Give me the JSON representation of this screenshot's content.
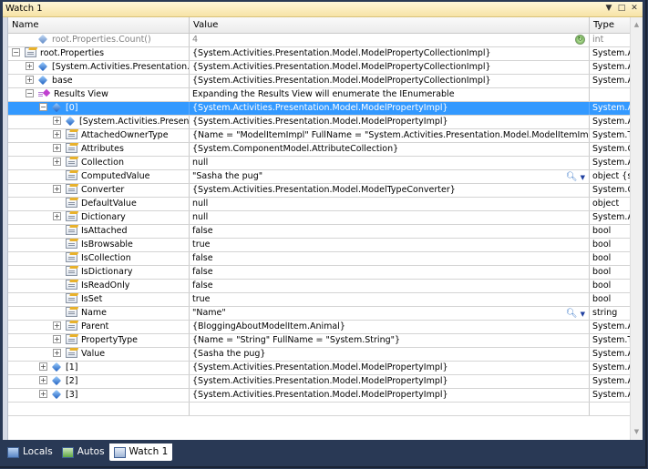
{
  "window": {
    "title": "Watch 1",
    "buttons": {
      "dropdown": "▼",
      "maximize": "□",
      "close": "✕"
    }
  },
  "columns": {
    "name": "Name",
    "value": "Value",
    "type": "Type"
  },
  "rows": [
    {
      "name": "root.Properties.Count()",
      "value": "4",
      "type": "int",
      "indent": 1,
      "expander": "none",
      "icon": "gem-grey-icon",
      "muted": true,
      "action": "refresh-icon"
    },
    {
      "name": "root.Properties",
      "value": "{System.Activities.Presentation.Model.ModelPropertyCollectionImpl}",
      "type": "System.A",
      "indent": 0,
      "expander": "minus",
      "icon": "property-icon"
    },
    {
      "name": "[System.Activities.Presentation.ModelPropertyCollectionImpl]",
      "value": "{System.Activities.Presentation.Model.ModelPropertyCollectionImpl}",
      "type": "System.A",
      "indent": 1,
      "expander": "plus",
      "icon": "gem-icon"
    },
    {
      "name": "base",
      "value": "{System.Activities.Presentation.Model.ModelPropertyCollectionImpl}",
      "type": "System.A",
      "indent": 1,
      "expander": "plus",
      "icon": "gem-icon"
    },
    {
      "name": "Results View",
      "value": "Expanding the Results View will enumerate the IEnumerable",
      "type": "",
      "indent": 1,
      "expander": "minus",
      "icon": "results-view-icon"
    },
    {
      "name": "[0]",
      "value": "{System.Activities.Presentation.Model.ModelPropertyImpl}",
      "type": "System.A",
      "indent": 2,
      "expander": "minus",
      "icon": "gem-icon",
      "selected": true
    },
    {
      "name": "[System.Activities.Presentation.Model.ModelPropertyImpl]",
      "value": "{System.Activities.Presentation.Model.ModelPropertyImpl}",
      "type": "System.A",
      "indent": 3,
      "expander": "plus",
      "icon": "gem-icon"
    },
    {
      "name": "AttachedOwnerType",
      "value": "{Name = \"ModelItemImpl\" FullName = \"System.Activities.Presentation.Model.ModelItemImpl\"}",
      "type": "System.T",
      "indent": 3,
      "expander": "plus",
      "icon": "property-icon"
    },
    {
      "name": "Attributes",
      "value": "{System.ComponentModel.AttributeCollection}",
      "type": "System.C",
      "indent": 3,
      "expander": "plus",
      "icon": "property-icon"
    },
    {
      "name": "Collection",
      "value": "null",
      "type": "System.A",
      "indent": 3,
      "expander": "plus",
      "icon": "property-icon"
    },
    {
      "name": "ComputedValue",
      "value": "\"Sasha the pug\"",
      "type": "object {st",
      "indent": 3,
      "expander": "none",
      "icon": "property-icon",
      "action": "visualizer"
    },
    {
      "name": "Converter",
      "value": "{System.Activities.Presentation.Model.ModelTypeConverter}",
      "type": "System.C",
      "indent": 3,
      "expander": "plus",
      "icon": "property-icon"
    },
    {
      "name": "DefaultValue",
      "value": "null",
      "type": "object",
      "indent": 3,
      "expander": "none",
      "icon": "property-icon"
    },
    {
      "name": "Dictionary",
      "value": "null",
      "type": "System.A",
      "indent": 3,
      "expander": "plus",
      "icon": "property-icon"
    },
    {
      "name": "IsAttached",
      "value": "false",
      "type": "bool",
      "indent": 3,
      "expander": "none",
      "icon": "property-icon"
    },
    {
      "name": "IsBrowsable",
      "value": "true",
      "type": "bool",
      "indent": 3,
      "expander": "none",
      "icon": "property-icon"
    },
    {
      "name": "IsCollection",
      "value": "false",
      "type": "bool",
      "indent": 3,
      "expander": "none",
      "icon": "property-icon"
    },
    {
      "name": "IsDictionary",
      "value": "false",
      "type": "bool",
      "indent": 3,
      "expander": "none",
      "icon": "property-icon"
    },
    {
      "name": "IsReadOnly",
      "value": "false",
      "type": "bool",
      "indent": 3,
      "expander": "none",
      "icon": "property-icon"
    },
    {
      "name": "IsSet",
      "value": "true",
      "type": "bool",
      "indent": 3,
      "expander": "none",
      "icon": "property-icon"
    },
    {
      "name": "Name",
      "value": "\"Name\"",
      "type": "string",
      "indent": 3,
      "expander": "none",
      "icon": "property-icon",
      "action": "visualizer"
    },
    {
      "name": "Parent",
      "value": "{BloggingAboutModelItem.Animal}",
      "type": "System.A",
      "indent": 3,
      "expander": "plus",
      "icon": "property-icon"
    },
    {
      "name": "PropertyType",
      "value": "{Name = \"String\" FullName = \"System.String\"}",
      "type": "System.T",
      "indent": 3,
      "expander": "plus",
      "icon": "property-icon"
    },
    {
      "name": "Value",
      "value": "{Sasha the pug}",
      "type": "System.A",
      "indent": 3,
      "expander": "plus",
      "icon": "property-icon"
    },
    {
      "name": "[1]",
      "value": "{System.Activities.Presentation.Model.ModelPropertyImpl}",
      "type": "System.A",
      "indent": 2,
      "expander": "plus",
      "icon": "gem-icon"
    },
    {
      "name": "[2]",
      "value": "{System.Activities.Presentation.Model.ModelPropertyImpl}",
      "type": "System.A",
      "indent": 2,
      "expander": "plus",
      "icon": "gem-icon"
    },
    {
      "name": "[3]",
      "value": "{System.Activities.Presentation.Model.ModelPropertyImpl}",
      "type": "System.A",
      "indent": 2,
      "expander": "plus",
      "icon": "gem-icon"
    },
    {
      "name": "",
      "value": "",
      "type": "",
      "indent": 0,
      "expander": "none",
      "icon": "",
      "empty": true
    }
  ],
  "tabs": [
    {
      "label": "Locals",
      "icon": "locals-icon",
      "active": false
    },
    {
      "label": "Autos",
      "icon": "autos-icon",
      "active": false
    },
    {
      "label": "Watch 1",
      "icon": "watch-icon",
      "active": true
    }
  ],
  "colors": {
    "selection": "#3399ff",
    "frame": "#293955",
    "titlebar": "#f7e3a6"
  }
}
